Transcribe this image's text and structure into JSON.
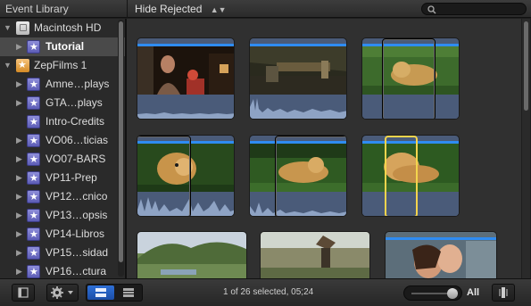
{
  "header": {
    "title": "Event Library",
    "filter": "Hide Rejected",
    "filter_arrows": "▲▼"
  },
  "sidebar": {
    "items": [
      {
        "label": "Macintosh HD",
        "icon": "hard-drive-icon",
        "expanded": true
      },
      {
        "label": "Tutorial",
        "icon": "event-star-icon",
        "selected": true
      },
      {
        "label": "ZepFilms 1",
        "icon": "project-star-icon",
        "expanded": true
      },
      {
        "label": "Amne…plays",
        "icon": "event-star-icon"
      },
      {
        "label": "GTA…plays",
        "icon": "event-star-icon"
      },
      {
        "label": "Intro-Credits",
        "icon": "event-star-icon"
      },
      {
        "label": "VO06…ticias",
        "icon": "event-star-icon"
      },
      {
        "label": "VO07-BARS",
        "icon": "event-star-icon"
      },
      {
        "label": "VP11-Prep",
        "icon": "event-star-icon"
      },
      {
        "label": "VP12…cnico",
        "icon": "event-star-icon"
      },
      {
        "label": "VP13…opsis",
        "icon": "event-star-icon"
      },
      {
        "label": "VP14-Libros",
        "icon": "event-star-icon"
      },
      {
        "label": "VP15…sidad",
        "icon": "event-star-icon"
      },
      {
        "label": "VP16…ctura",
        "icon": "event-star-icon"
      }
    ]
  },
  "footer": {
    "status": "1 of 26 selected, 05;24",
    "zoom_label": "All",
    "zoom_level": 0.85
  },
  "colors": {
    "accent_blue": "#2f8cf2",
    "selection_yellow": "#f4d44d",
    "waveform": "#4a5b79"
  }
}
